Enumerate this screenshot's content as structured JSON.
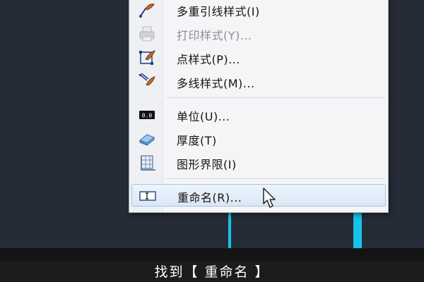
{
  "menu": {
    "items": [
      {
        "label": "多重引线样式(I)",
        "icon": "multileader-style-icon",
        "enabled": true
      },
      {
        "label": "打印样式(Y)...",
        "icon": "print-style-icon",
        "enabled": false
      },
      {
        "label": "点样式(P)...",
        "icon": "point-style-icon",
        "enabled": true
      },
      {
        "label": "多线样式(M)...",
        "icon": "multiline-style-icon",
        "enabled": true
      },
      {
        "label": "单位(U)...",
        "icon": "units-icon",
        "enabled": true
      },
      {
        "label": "厚度(T)",
        "icon": "thickness-icon",
        "enabled": true
      },
      {
        "label": "图形界限(I)",
        "icon": "drawing-limits-icon",
        "enabled": true
      },
      {
        "label": "重命名(R)...",
        "icon": "rename-icon",
        "enabled": true,
        "highlighted": true
      }
    ]
  },
  "subtitle": {
    "text": "找到【 重命名 】"
  },
  "colors": {
    "canvas": "#252c37",
    "accent_lines": "#19c2e8",
    "menu_bg": "#f4f5f7",
    "highlight": "#dbe7f5"
  }
}
